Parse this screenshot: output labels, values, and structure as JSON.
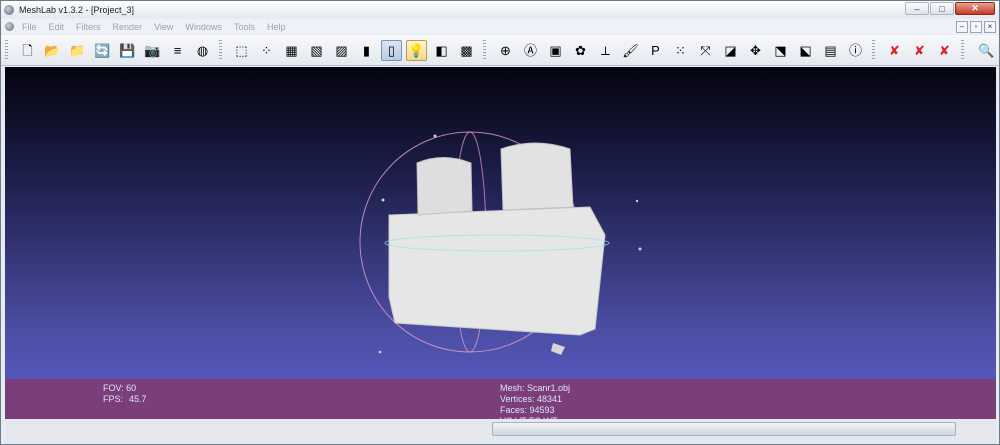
{
  "window": {
    "title": "MeshLab v1.3.2 - [Project_3]",
    "controls": {
      "minimize": "–",
      "maximize": "□",
      "close": "✕"
    }
  },
  "menu": {
    "items": [
      "File",
      "Edit",
      "Filters",
      "Render",
      "View",
      "Windows",
      "Tools",
      "Help"
    ],
    "mdi_controls": [
      "–",
      "▫",
      "×"
    ]
  },
  "toolbar": {
    "groups": [
      [
        "new-project-icon",
        "open-project-icon",
        "open-mesh-icon",
        "reload-icon",
        "save-icon",
        "snapshot-icon",
        "layers-icon",
        "sphere-icon"
      ],
      [
        "bbox-icon",
        "points-icon",
        "wireframe-icon",
        "hidden-lines-icon",
        "flat-lines-icon",
        "flat-icon",
        "smooth-icon",
        "lighting-icon",
        "back-face-icon",
        "texture-icon"
      ],
      [
        "trackball-icon",
        "annotate-icon",
        "measure-icon",
        "select-faces-icon",
        "axis-icon",
        "paint-icon",
        "pickpoints-icon",
        "select-vertices-icon",
        "align-icon",
        "color-mesh-icon",
        "move-icon",
        "select-connected-icon",
        "manipulate-icon",
        "image-align-icon",
        "info-icon"
      ],
      [
        "delete-faces-icon",
        "delete-vertices-icon",
        "delete-selection-icon"
      ],
      [
        "search-icon"
      ]
    ],
    "glyphs": {
      "new-project-icon": "🗋",
      "open-project-icon": "📂",
      "open-mesh-icon": "📁",
      "reload-icon": "🔄",
      "save-icon": "💾",
      "snapshot-icon": "📷",
      "layers-icon": "≡",
      "sphere-icon": "◍",
      "bbox-icon": "⬚",
      "points-icon": "⁘",
      "wireframe-icon": "▦",
      "hidden-lines-icon": "▧",
      "flat-lines-icon": "▨",
      "flat-icon": "▮",
      "smooth-icon": "▯",
      "lighting-icon": "💡",
      "back-face-icon": "◧",
      "texture-icon": "▩",
      "trackball-icon": "⊕",
      "annotate-icon": "Ⓐ",
      "measure-icon": "▣",
      "select-faces-icon": "✿",
      "axis-icon": "⟂",
      "paint-icon": "🖌",
      "pickpoints-icon": "P",
      "select-vertices-icon": "⁙",
      "align-icon": "⤧",
      "color-mesh-icon": "◪",
      "move-icon": "✥",
      "select-connected-icon": "⬔",
      "manipulate-icon": "⬕",
      "image-align-icon": "▤",
      "info-icon": "ⓘ",
      "delete-faces-icon": "✘",
      "delete-vertices-icon": "✘",
      "delete-selection-icon": "✘",
      "search-icon": "🔍"
    },
    "active": "lighting-icon",
    "pressed": "smooth-icon"
  },
  "viewport": {
    "fov_label": "FOV: 60",
    "fps_label": "FPS:",
    "fps_value": "45.7",
    "mesh_label": "Mesh: Scanr1.obj",
    "vertices_label": "Vertices: 48341",
    "faces_label": "Faces: 94593",
    "attribs_label": "VC VT FC WT"
  },
  "colors": {
    "background_top": "#04040f",
    "background_bottom": "#6262d6",
    "info_bar": "#7a3f7a",
    "mesh": "#e6e6e6",
    "trackball_ring": "#e6a0c8"
  }
}
